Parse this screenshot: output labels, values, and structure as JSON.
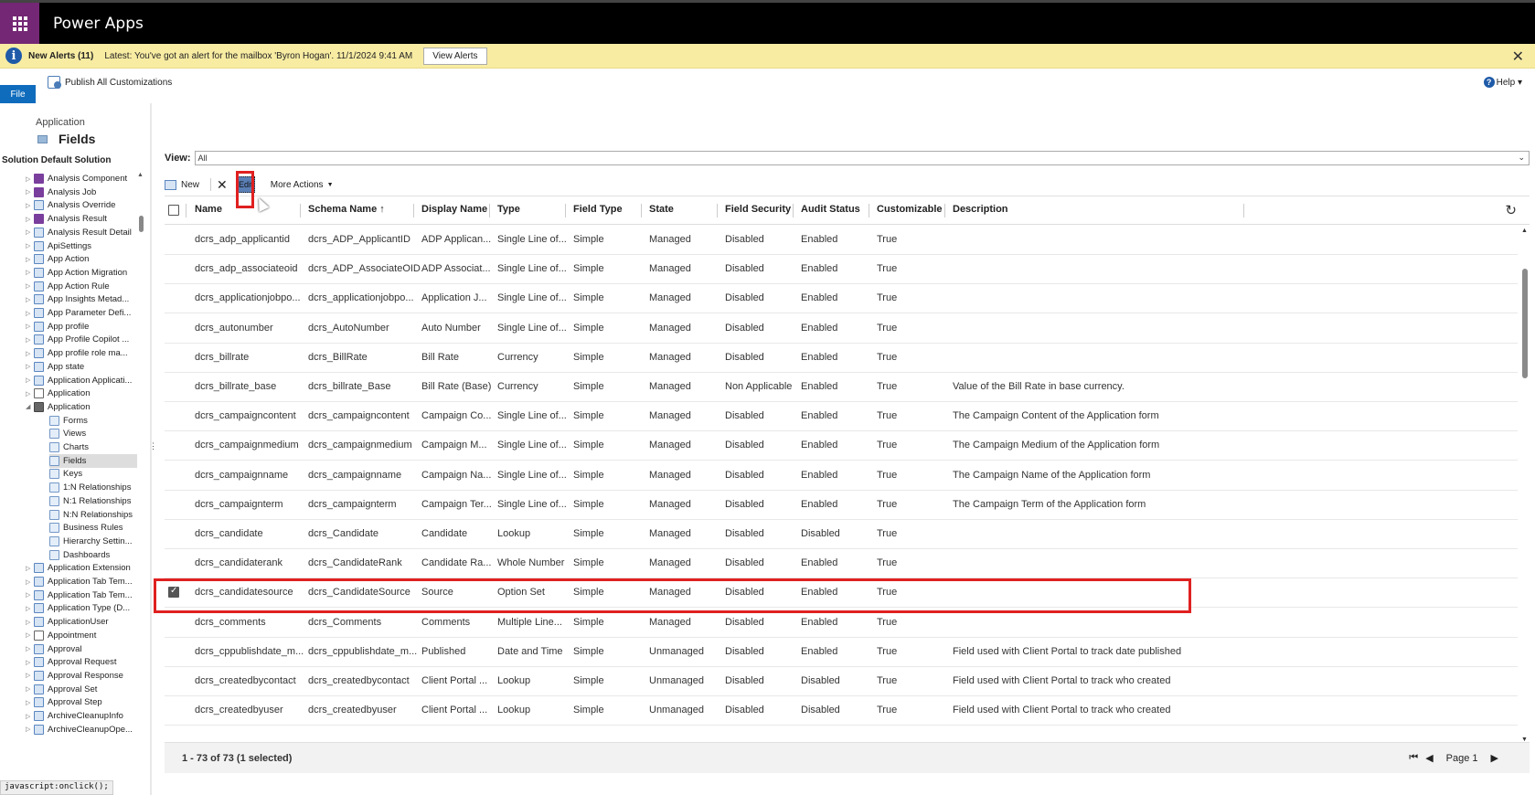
{
  "app": {
    "title": "Power Apps"
  },
  "alert": {
    "title": "New Alerts (11)",
    "message": "Latest: You've got an alert for the mailbox 'Byron Hogan'. 11/1/2024 9:41 AM",
    "button": "View Alerts",
    "close": "✕"
  },
  "ribbon": {
    "file": "File",
    "publish": "Publish All Customizations",
    "help": "Help ▾"
  },
  "left": {
    "entity": "Application",
    "page_title": "Fields",
    "solution": "Solution Default Solution",
    "tree": [
      {
        "label": "Analysis Component",
        "icon": "purple",
        "level": 0
      },
      {
        "label": "Analysis Job",
        "icon": "purple",
        "level": 0
      },
      {
        "label": "Analysis Override",
        "icon": "blue",
        "level": 0
      },
      {
        "label": "Analysis Result",
        "icon": "purple",
        "level": 0
      },
      {
        "label": "Analysis Result Detail",
        "icon": "blue",
        "level": 0
      },
      {
        "label": "ApiSettings",
        "icon": "blue",
        "level": 0
      },
      {
        "label": "App Action",
        "icon": "blue",
        "level": 0
      },
      {
        "label": "App Action Migration",
        "icon": "blue",
        "level": 0
      },
      {
        "label": "App Action Rule",
        "icon": "blue",
        "level": 0
      },
      {
        "label": "App Insights Metad...",
        "icon": "blue",
        "level": 0
      },
      {
        "label": "App Parameter Defi...",
        "icon": "blue",
        "level": 0
      },
      {
        "label": "App profile",
        "icon": "blue",
        "level": 0
      },
      {
        "label": "App Profile Copilot ...",
        "icon": "blue",
        "level": 0
      },
      {
        "label": "App profile role ma...",
        "icon": "blue",
        "level": 0
      },
      {
        "label": "App state",
        "icon": "blue",
        "level": 0
      },
      {
        "label": "Application Applicati...",
        "icon": "blue",
        "level": 0
      },
      {
        "label": "Application",
        "icon": "gray",
        "level": 0
      },
      {
        "label": "Application",
        "icon": "check",
        "level": 0,
        "expanded": true
      },
      {
        "label": "Forms",
        "icon": "sub",
        "level": 1
      },
      {
        "label": "Views",
        "icon": "sub",
        "level": 1
      },
      {
        "label": "Charts",
        "icon": "sub",
        "level": 1
      },
      {
        "label": "Fields",
        "icon": "sub",
        "level": 1,
        "selected": true
      },
      {
        "label": "Keys",
        "icon": "sub",
        "level": 1
      },
      {
        "label": "1:N Relationships",
        "icon": "sub",
        "level": 1
      },
      {
        "label": "N:1 Relationships",
        "icon": "sub",
        "level": 1
      },
      {
        "label": "N:N Relationships",
        "icon": "sub",
        "level": 1
      },
      {
        "label": "Business Rules",
        "icon": "sub",
        "level": 1
      },
      {
        "label": "Hierarchy Settin...",
        "icon": "sub",
        "level": 1
      },
      {
        "label": "Dashboards",
        "icon": "sub",
        "level": 1
      },
      {
        "label": "Application Extension",
        "icon": "blue",
        "level": 0
      },
      {
        "label": "Application Tab Tem...",
        "icon": "blue",
        "level": 0
      },
      {
        "label": "Application Tab Tem...",
        "icon": "blue",
        "level": 0
      },
      {
        "label": "Application Type (D...",
        "icon": "blue",
        "level": 0
      },
      {
        "label": "ApplicationUser",
        "icon": "blue",
        "level": 0
      },
      {
        "label": "Appointment",
        "icon": "gray",
        "level": 0
      },
      {
        "label": "Approval",
        "icon": "blue",
        "level": 0
      },
      {
        "label": "Approval Request",
        "icon": "blue",
        "level": 0
      },
      {
        "label": "Approval Response",
        "icon": "blue",
        "level": 0
      },
      {
        "label": "Approval Set",
        "icon": "blue",
        "level": 0
      },
      {
        "label": "Approval Step",
        "icon": "blue",
        "level": 0
      },
      {
        "label": "ArchiveCleanupInfo",
        "icon": "blue",
        "level": 0
      },
      {
        "label": "ArchiveCleanupOpe...",
        "icon": "blue",
        "level": 0
      }
    ]
  },
  "view": {
    "label": "View:",
    "value": "All"
  },
  "commands": {
    "new": "New",
    "edit": "Edit",
    "more": "More Actions"
  },
  "grid": {
    "headers": [
      "Name",
      "Schema Name ↑",
      "Display Name",
      "Type",
      "Field Type",
      "State",
      "Field Security",
      "Audit Status",
      "Customizable",
      "Description"
    ],
    "rows": [
      [
        "dcrs_adp_applicantid",
        "dcrs_ADP_ApplicantID",
        "ADP Applican...",
        "Single Line of...",
        "Simple",
        "Managed",
        "Disabled",
        "Enabled",
        "True",
        ""
      ],
      [
        "dcrs_adp_associateoid",
        "dcrs_ADP_AssociateOID",
        "ADP Associat...",
        "Single Line of...",
        "Simple",
        "Managed",
        "Disabled",
        "Enabled",
        "True",
        ""
      ],
      [
        "dcrs_applicationjobpo...",
        "dcrs_applicationjobpo...",
        "Application J...",
        "Single Line of...",
        "Simple",
        "Managed",
        "Disabled",
        "Enabled",
        "True",
        ""
      ],
      [
        "dcrs_autonumber",
        "dcrs_AutoNumber",
        "Auto Number",
        "Single Line of...",
        "Simple",
        "Managed",
        "Disabled",
        "Enabled",
        "True",
        ""
      ],
      [
        "dcrs_billrate",
        "dcrs_BillRate",
        "Bill Rate",
        "Currency",
        "Simple",
        "Managed",
        "Disabled",
        "Enabled",
        "True",
        ""
      ],
      [
        "dcrs_billrate_base",
        "dcrs_billrate_Base",
        "Bill Rate (Base)",
        "Currency",
        "Simple",
        "Managed",
        "Non Applicable",
        "Enabled",
        "True",
        "Value of the Bill Rate in base currency."
      ],
      [
        "dcrs_campaigncontent",
        "dcrs_campaigncontent",
        "Campaign Co...",
        "Single Line of...",
        "Simple",
        "Managed",
        "Disabled",
        "Enabled",
        "True",
        "The Campaign Content of the Application form"
      ],
      [
        "dcrs_campaignmedium",
        "dcrs_campaignmedium",
        "Campaign M...",
        "Single Line of...",
        "Simple",
        "Managed",
        "Disabled",
        "Enabled",
        "True",
        "The Campaign Medium of the Application form"
      ],
      [
        "dcrs_campaignname",
        "dcrs_campaignname",
        "Campaign Na...",
        "Single Line of...",
        "Simple",
        "Managed",
        "Disabled",
        "Enabled",
        "True",
        "The Campaign Name of the Application form"
      ],
      [
        "dcrs_campaignterm",
        "dcrs_campaignterm",
        "Campaign Ter...",
        "Single Line of...",
        "Simple",
        "Managed",
        "Disabled",
        "Enabled",
        "True",
        "The Campaign Term of the Application form"
      ],
      [
        "dcrs_candidate",
        "dcrs_Candidate",
        "Candidate",
        "Lookup",
        "Simple",
        "Managed",
        "Disabled",
        "Disabled",
        "True",
        ""
      ],
      [
        "dcrs_candidaterank",
        "dcrs_CandidateRank",
        "Candidate Ra...",
        "Whole Number",
        "Simple",
        "Managed",
        "Disabled",
        "Enabled",
        "True",
        ""
      ],
      [
        "dcrs_candidatesource",
        "dcrs_CandidateSource",
        "Source",
        "Option Set",
        "Simple",
        "Managed",
        "Disabled",
        "Enabled",
        "True",
        ""
      ],
      [
        "dcrs_comments",
        "dcrs_Comments",
        "Comments",
        "Multiple Line...",
        "Simple",
        "Managed",
        "Disabled",
        "Enabled",
        "True",
        ""
      ],
      [
        "dcrs_cppublishdate_m...",
        "dcrs_cppublishdate_m...",
        "Published",
        "Date and Time",
        "Simple",
        "Unmanaged",
        "Disabled",
        "Enabled",
        "True",
        "Field used with Client Portal to track date published"
      ],
      [
        "dcrs_createdbycontact",
        "dcrs_createdbycontact",
        "Client Portal ...",
        "Lookup",
        "Simple",
        "Unmanaged",
        "Disabled",
        "Disabled",
        "True",
        "Field used with Client Portal to track who created"
      ],
      [
        "dcrs_createdbyuser",
        "dcrs_createdbyuser",
        "Client Portal ...",
        "Lookup",
        "Simple",
        "Unmanaged",
        "Disabled",
        "Disabled",
        "True",
        "Field used with Client Portal to track who created"
      ]
    ],
    "selected_row": 12
  },
  "footer": {
    "count": "1 - 73 of 73 (1 selected)",
    "page": "Page 1"
  },
  "status": {
    "text": "javascript:onclick();"
  }
}
